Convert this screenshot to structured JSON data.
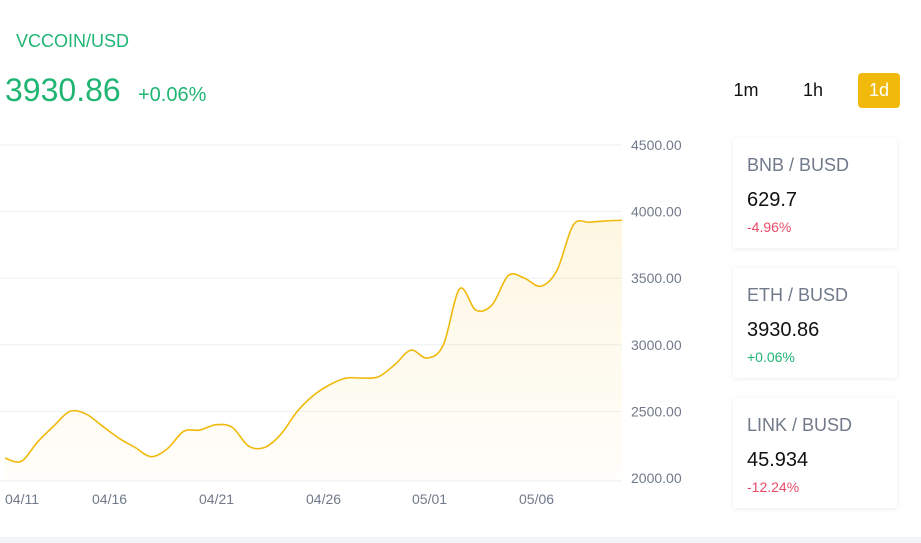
{
  "header": {
    "pair": "VCCOIN/USD",
    "price": "3930.86",
    "change": "+0.06%"
  },
  "timeframes": [
    {
      "label": "1m",
      "active": false
    },
    {
      "label": "1h",
      "active": false
    },
    {
      "label": "1d",
      "active": true
    }
  ],
  "colors": {
    "accent": "#f0b90b",
    "positive": "#21b573",
    "negative": "#e84b66"
  },
  "tickers": [
    {
      "pair": "BNB / BUSD",
      "price": "629.7",
      "change": "-4.96%"
    },
    {
      "pair": "ETH / BUSD",
      "price": "3930.86",
      "change": "+0.06%"
    },
    {
      "pair": "LINK / BUSD",
      "price": "45.934",
      "change": "-12.24%"
    }
  ],
  "chart_data": {
    "type": "area",
    "x_tick_labels": [
      "04/11",
      "04/16",
      "04/21",
      "04/26",
      "05/01",
      "05/06"
    ],
    "y_tick_labels": [
      "4500.00",
      "4000.00",
      "3500.00",
      "3000.00",
      "2500.00",
      "2000.00"
    ],
    "ylim": [
      2000,
      4500
    ],
    "grid": true,
    "series": [
      {
        "values": [
          [
            0,
            2150
          ],
          [
            1,
            2125
          ],
          [
            2,
            2270
          ],
          [
            3,
            2390
          ],
          [
            4,
            2500
          ],
          [
            5,
            2480
          ],
          [
            6,
            2390
          ],
          [
            7,
            2300
          ],
          [
            8,
            2230
          ],
          [
            9,
            2160
          ],
          [
            10,
            2220
          ],
          [
            11,
            2350
          ],
          [
            12,
            2360
          ],
          [
            13,
            2400
          ],
          [
            14,
            2380
          ],
          [
            15,
            2240
          ],
          [
            16,
            2230
          ],
          [
            17,
            2330
          ],
          [
            18,
            2500
          ],
          [
            19,
            2620
          ],
          [
            20,
            2700
          ],
          [
            21,
            2750
          ],
          [
            22,
            2750
          ],
          [
            23,
            2760
          ],
          [
            24,
            2850
          ],
          [
            25,
            2960
          ],
          [
            26,
            2900
          ],
          [
            27,
            3000
          ],
          [
            28,
            3420
          ],
          [
            29,
            3260
          ],
          [
            30,
            3300
          ],
          [
            31,
            3520
          ],
          [
            32,
            3500
          ],
          [
            33,
            3440
          ],
          [
            34,
            3560
          ],
          [
            35,
            3900
          ],
          [
            36,
            3920
          ],
          [
            37,
            3930
          ],
          [
            38,
            3935
          ]
        ]
      }
    ]
  }
}
